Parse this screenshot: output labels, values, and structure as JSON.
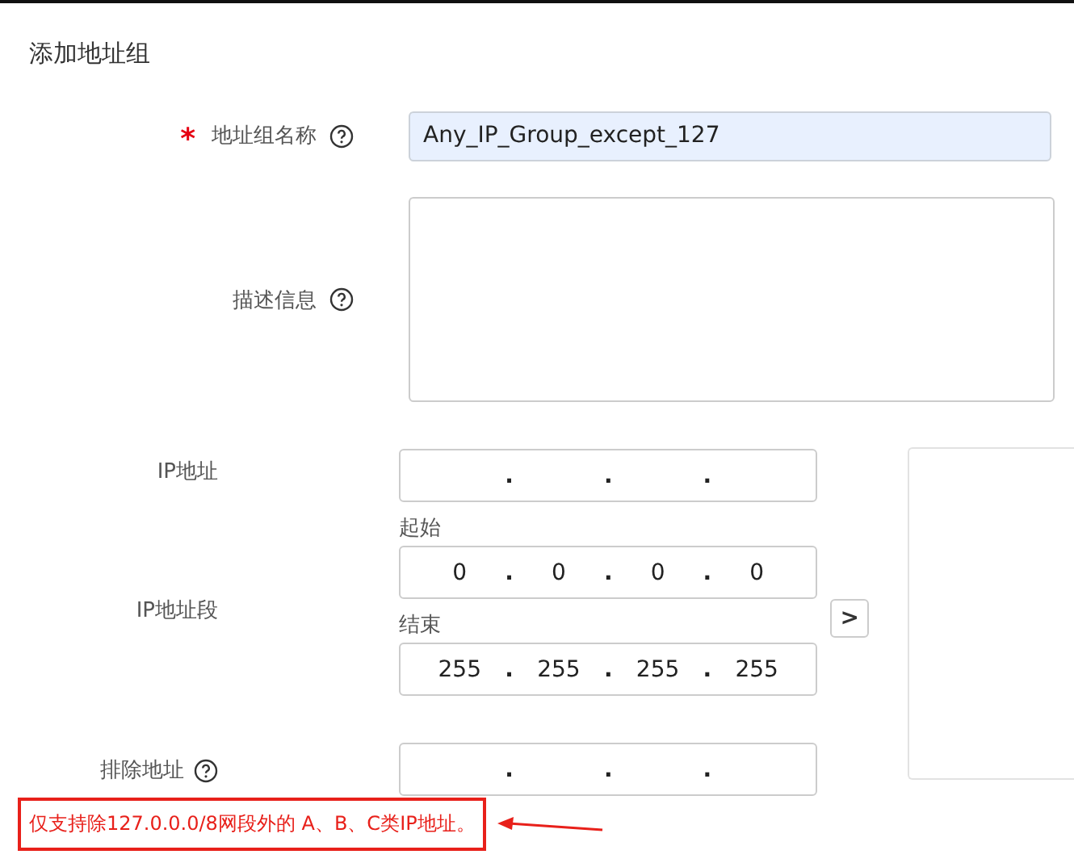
{
  "title": "添加地址组",
  "upper_fields": [
    {
      "kind": "input",
      "required_mark": "*",
      "label": "地址组名称",
      "value": "Any_IP_Group_except_127"
    },
    {
      "kind": "textarea",
      "label": "描述信息"
    }
  ],
  "ip_address": {
    "label": "IP地址"
  },
  "ip_range": {
    "label": "IP地址段",
    "start_label": "起始",
    "start": [
      "0",
      "0",
      "0",
      "0"
    ],
    "end_label": "结束",
    "end": [
      "255",
      "255",
      "255",
      "255"
    ],
    "add_button": ">"
  },
  "exclude": {
    "label": "排除地址"
  },
  "separator": ".",
  "annotation": {
    "text": "仅支持除127.0.0.0/8网段外的 A、B、C类IP地址。"
  }
}
